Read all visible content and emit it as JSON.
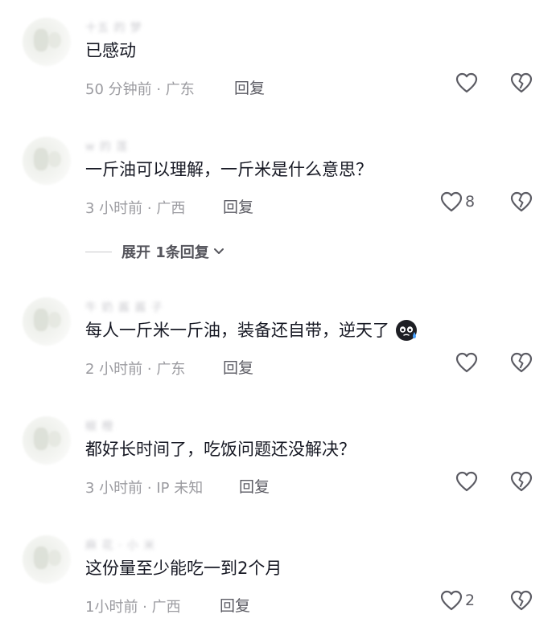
{
  "comments": [
    {
      "username": "十五 的 梦",
      "text": "已感动",
      "meta": "50 分钟前 · 广东",
      "reply_label": "回复",
      "likes": ""
    },
    {
      "username": "w 的 莲",
      "text": "一斤油可以理解，一斤米是什么意思？",
      "meta": "3 小时前 · 广西",
      "reply_label": "回复",
      "likes": "8"
    },
    {
      "username": "牛 奶 酱 酱 子",
      "text": "每人一斤米一斤油，装备还自带，逆天了",
      "emoji": "sweat-emoji",
      "meta": "2 小时前 · 广东",
      "reply_label": "回复",
      "likes": ""
    },
    {
      "username": "椒 橙",
      "text": "都好长时间了，吃饭问题还没解决？",
      "meta": "3 小时前 · IP 未知",
      "reply_label": "回复",
      "likes": ""
    },
    {
      "username": "麻 花 · 小 米",
      "text": "这份量至少能吃一到2个月",
      "meta": "1小时前 · 广西",
      "reply_label": "回复",
      "likes": "2"
    }
  ],
  "expand_replies_label": "展开 1条回复",
  "icons": {
    "like": "heart-outline-icon",
    "dislike": "broken-heart-icon",
    "expand": "chevron-down-icon"
  },
  "colors": {
    "text": "#161823",
    "meta": "#9b9ba0",
    "action": "#5b5b63"
  }
}
